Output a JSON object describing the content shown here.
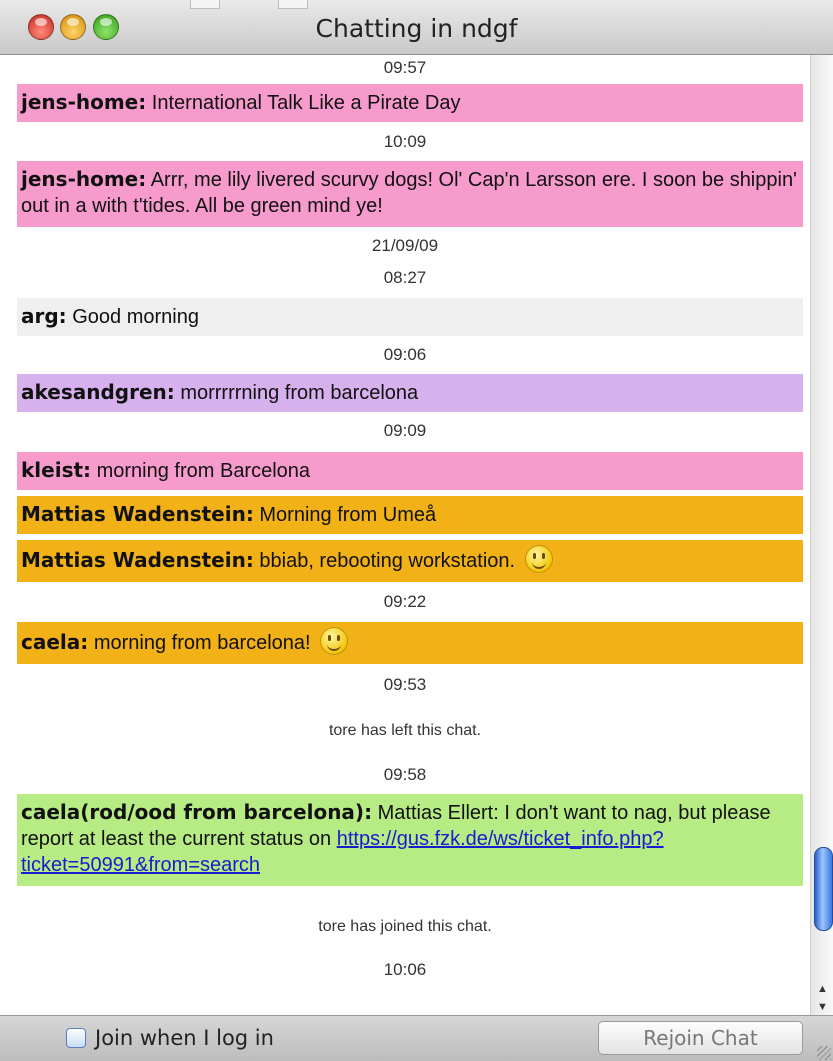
{
  "window": {
    "title": "Chatting in ndgf"
  },
  "colors": {
    "pink": "#f79bcd",
    "lavender": "#d7b0ee",
    "orange": "#f1b117",
    "green": "#b7ec84",
    "light_gray": "#efefef"
  },
  "chat": {
    "ts1": "09:57",
    "m1": {
      "sender": "jens-home:",
      "text": " International Talk Like a Pirate Day"
    },
    "ts2": "10:09",
    "m2": {
      "sender": "jens-home:",
      "text": " Arrr, me lily livered scurvy dogs! Ol' Cap'n Larsson ere. I soon be shippin' out in a with t'tides. All be green mind ye!"
    },
    "date": "21/09/09",
    "ts3": "08:27",
    "m3": {
      "sender": "arg:",
      "text": " Good morning"
    },
    "ts4": "09:06",
    "m4": {
      "sender": "akesandgren:",
      "text": " morrrrrning from barcelona"
    },
    "ts5": "09:09",
    "m5": {
      "sender": "kleist:",
      "text": " morning from Barcelona"
    },
    "m6": {
      "sender": "Mattias Wadenstein:",
      "text": " Morning from Umeå"
    },
    "m7": {
      "sender": "Mattias Wadenstein:",
      "text": " bbiab, rebooting workstation. "
    },
    "ts6": "09:22",
    "m8": {
      "sender": "caela:",
      "text": " morning from barcelona! "
    },
    "ts7": "09:53",
    "sys1": "tore has left this chat.",
    "ts8": "09:58",
    "m9": {
      "sender": "caela(rod/ood from barcelona):",
      "text": " Mattias Ellert: I don't want to nag, but please report at least the current status on ",
      "link": "https://gus.fzk.de/ws/ticket_info.php?ticket=50991&from=search"
    },
    "sys2": "tore has joined this chat.",
    "ts9": "10:06"
  },
  "scroll": {
    "arrow_up": "▲",
    "arrow_down": "▼"
  },
  "footer": {
    "join_label": "Join when I log in",
    "join_checked": false,
    "rejoin_label": "Rejoin Chat"
  }
}
